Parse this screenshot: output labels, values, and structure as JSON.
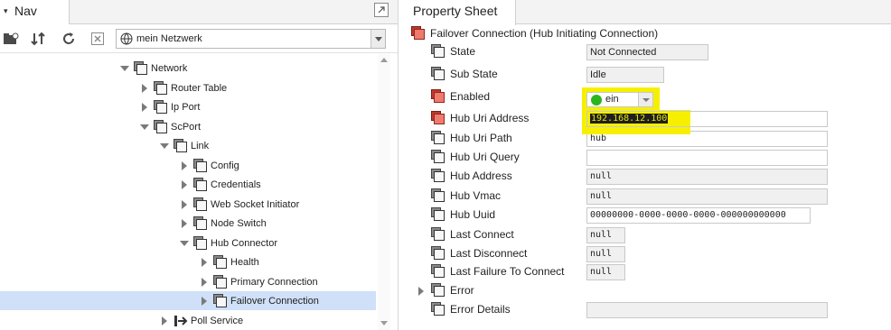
{
  "nav": {
    "title": "Nav",
    "selector": {
      "value": "mein Netzwerk"
    },
    "tree": [
      {
        "label": "Network",
        "state": "expanded"
      },
      {
        "label": "Router Table",
        "state": "collapsed"
      },
      {
        "label": "Ip Port",
        "state": "collapsed"
      },
      {
        "label": "ScPort",
        "state": "expanded"
      },
      {
        "label": "Link",
        "state": "expanded"
      },
      {
        "label": "Config",
        "state": "collapsed"
      },
      {
        "label": "Credentials",
        "state": "collapsed"
      },
      {
        "label": "Web Socket Initiator",
        "state": "collapsed"
      },
      {
        "label": "Node Switch",
        "state": "collapsed"
      },
      {
        "label": "Hub Connector",
        "state": "expanded"
      },
      {
        "label": "Health",
        "state": "collapsed"
      },
      {
        "label": "Primary Connection",
        "state": "collapsed"
      },
      {
        "label": "Failover Connection",
        "state": "collapsed",
        "selected": true
      },
      {
        "label": "Poll Service",
        "state": "collapsed"
      }
    ]
  },
  "property_sheet": {
    "tab": "Property Sheet",
    "title": "Failover Connection  (Hub Initiating Connection)",
    "properties": [
      {
        "label": "State",
        "value": "Not Connected"
      },
      {
        "label": "Sub State",
        "value": "Idle"
      },
      {
        "label": "Enabled",
        "value": "ein",
        "status_color": "#2bb51f"
      },
      {
        "label": "Hub Uri Address",
        "value": "192.168.12.100"
      },
      {
        "label": "Hub Uri Path",
        "value": "hub"
      },
      {
        "label": "Hub Uri Query",
        "value": ""
      },
      {
        "label": "Hub Address",
        "value": "null"
      },
      {
        "label": "Hub Vmac",
        "value": "null"
      },
      {
        "label": "Hub Uuid",
        "value": "00000000-0000-0000-0000-000000000000"
      },
      {
        "label": "Last Connect",
        "value": "null"
      },
      {
        "label": "Last Disconnect",
        "value": "null"
      },
      {
        "label": "Last Failure To Connect",
        "value": "null"
      },
      {
        "label": "Error",
        "value": ""
      },
      {
        "label": "Error Details",
        "value": ""
      }
    ]
  },
  "colors": {
    "highlight": "#f6f000",
    "selection": "#cfe0f8",
    "alarm_icon": "#c0392b"
  }
}
